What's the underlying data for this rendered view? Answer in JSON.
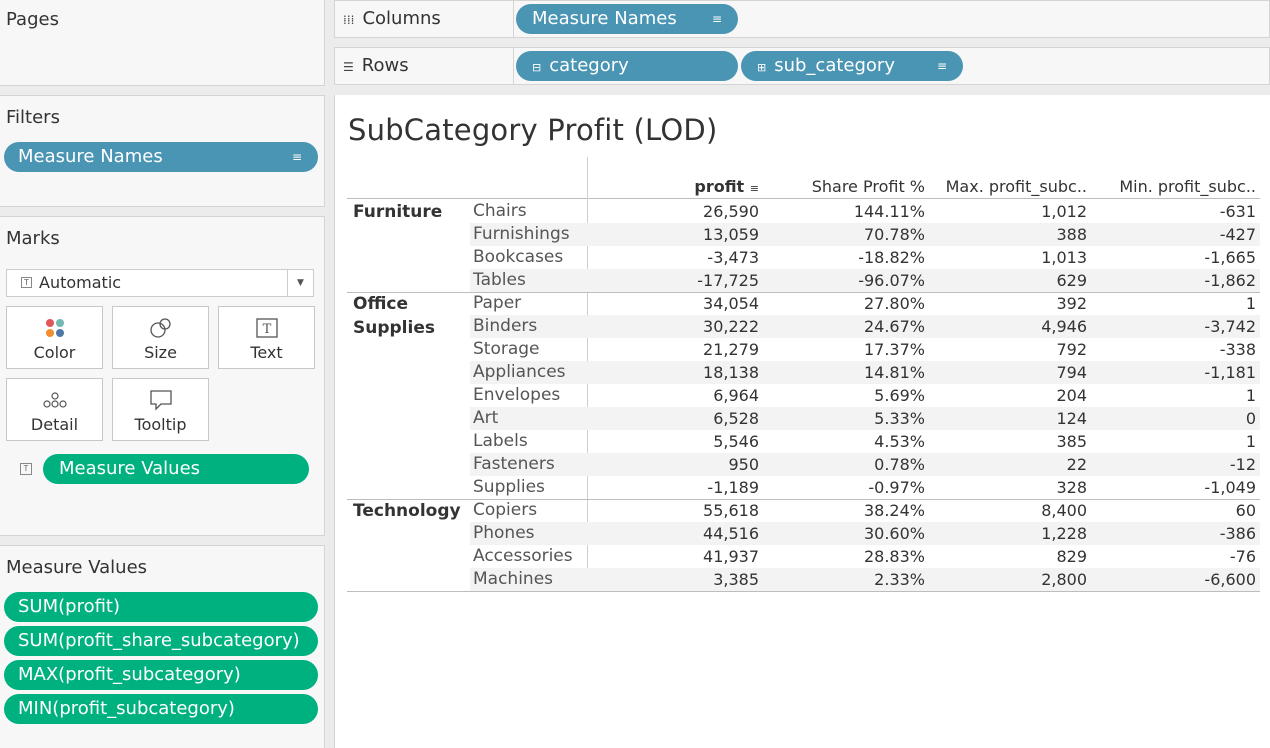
{
  "pages": {
    "title": "Pages"
  },
  "filters": {
    "title": "Filters",
    "pills": [
      "Measure Names"
    ]
  },
  "marks": {
    "title": "Marks",
    "mark_type": "Automatic",
    "buttons": [
      {
        "label": "Color",
        "icon": "color-icon"
      },
      {
        "label": "Size",
        "icon": "size-icon"
      },
      {
        "label": "Text",
        "icon": "text-icon"
      },
      {
        "label": "Detail",
        "icon": "detail-icon"
      },
      {
        "label": "Tooltip",
        "icon": "tooltip-icon"
      }
    ],
    "field_pill": "Measure Values"
  },
  "measure_values": {
    "title": "Measure Values",
    "pills": [
      "SUM(profit)",
      "SUM(profit_share_subcategory)",
      "MAX(profit_subcategory)",
      "MIN(profit_subcategory)"
    ]
  },
  "shelves": {
    "columns": {
      "label": "Columns",
      "pills": [
        "Measure Names"
      ]
    },
    "rows": {
      "label": "Rows",
      "pills": [
        "category",
        "sub_category"
      ]
    }
  },
  "view": {
    "title": "SubCategory Profit (LOD)",
    "headers": [
      "profit",
      "Share Profit %",
      "Max. profit_subc..",
      "Min. profit_subc.."
    ],
    "groups": [
      {
        "category": "Furniture",
        "rows": [
          {
            "sub": "Chairs",
            "profit": "26,590",
            "share": "144.11%",
            "max": "1,012",
            "min": "-631"
          },
          {
            "sub": "Furnishings",
            "profit": "13,059",
            "share": "70.78%",
            "max": "388",
            "min": "-427"
          },
          {
            "sub": "Bookcases",
            "profit": "-3,473",
            "share": "-18.82%",
            "max": "1,013",
            "min": "-1,665"
          },
          {
            "sub": "Tables",
            "profit": "-17,725",
            "share": "-96.07%",
            "max": "629",
            "min": "-1,862"
          }
        ]
      },
      {
        "category": "Office Supplies",
        "rows": [
          {
            "sub": "Paper",
            "profit": "34,054",
            "share": "27.80%",
            "max": "392",
            "min": "1"
          },
          {
            "sub": "Binders",
            "profit": "30,222",
            "share": "24.67%",
            "max": "4,946",
            "min": "-3,742"
          },
          {
            "sub": "Storage",
            "profit": "21,279",
            "share": "17.37%",
            "max": "792",
            "min": "-338"
          },
          {
            "sub": "Appliances",
            "profit": "18,138",
            "share": "14.81%",
            "max": "794",
            "min": "-1,181"
          },
          {
            "sub": "Envelopes",
            "profit": "6,964",
            "share": "5.69%",
            "max": "204",
            "min": "1"
          },
          {
            "sub": "Art",
            "profit": "6,528",
            "share": "5.33%",
            "max": "124",
            "min": "0"
          },
          {
            "sub": "Labels",
            "profit": "5,546",
            "share": "4.53%",
            "max": "385",
            "min": "1"
          },
          {
            "sub": "Fasteners",
            "profit": "950",
            "share": "0.78%",
            "max": "22",
            "min": "-12"
          },
          {
            "sub": "Supplies",
            "profit": "-1,189",
            "share": "-0.97%",
            "max": "328",
            "min": "-1,049"
          }
        ]
      },
      {
        "category": "Technology",
        "rows": [
          {
            "sub": "Copiers",
            "profit": "55,618",
            "share": "38.24%",
            "max": "8,400",
            "min": "60"
          },
          {
            "sub": "Phones",
            "profit": "44,516",
            "share": "30.60%",
            "max": "1,228",
            "min": "-386"
          },
          {
            "sub": "Accessories",
            "profit": "41,937",
            "share": "28.83%",
            "max": "829",
            "min": "-76"
          },
          {
            "sub": "Machines",
            "profit": "3,385",
            "share": "2.33%",
            "max": "2,800",
            "min": "-6,600"
          }
        ]
      }
    ]
  },
  "colors": {
    "dimension_pill": "#4a95b4",
    "measure_pill": "#00b180"
  }
}
